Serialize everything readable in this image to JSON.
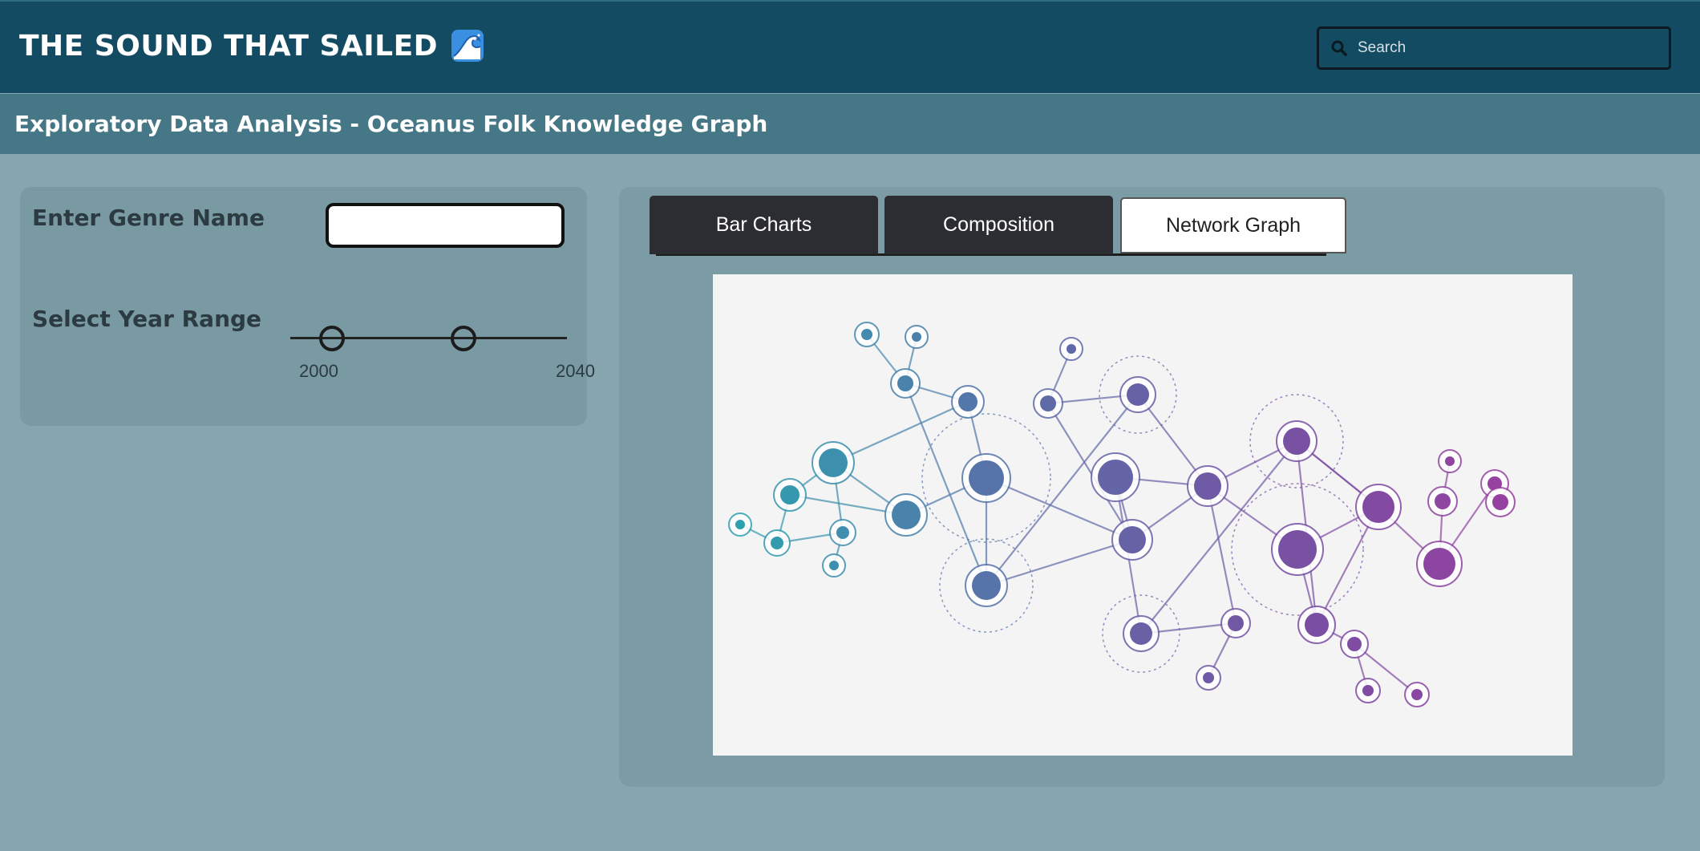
{
  "header": {
    "app_title": "THE SOUND THAT SAILED",
    "logo_icon": "water-wave-icon",
    "search_placeholder": "Search",
    "search_value": ""
  },
  "subheader": {
    "title": "Exploratory Data Analysis - Oceanus Folk Knowledge Graph"
  },
  "filters": {
    "genre_label": "Enter Genre Name",
    "genre_value": "",
    "year_label": "Select Year Range",
    "year_min_label": "2000",
    "year_max_label": "2040",
    "year_range": {
      "min": 2000,
      "max": 2040,
      "low": 2006,
      "high": 2025
    }
  },
  "tabs": [
    {
      "label": "Bar Charts",
      "active": false
    },
    {
      "label": "Composition",
      "active": false
    },
    {
      "label": "Network Graph",
      "active": true
    }
  ],
  "network_image": {
    "description_icon": "network-graph-illustration",
    "colors": {
      "teal": "#2aa6b0",
      "blue": "#5a6fa8",
      "purple": "#7a4fa3",
      "magenta": "#a03c9e"
    }
  },
  "colors": {
    "topbar": "#134c62",
    "subheader": "#467787",
    "page_background": "#86a5af",
    "panel": "#7a9aa3",
    "tab_dark": "#2b2d33"
  }
}
